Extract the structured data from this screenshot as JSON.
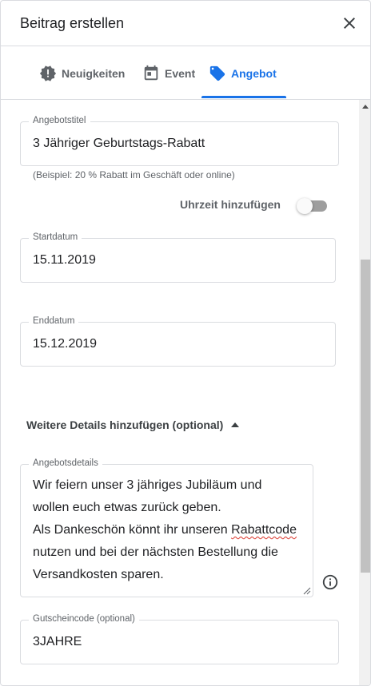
{
  "dialog": {
    "title": "Beitrag erstellen"
  },
  "tabs": [
    {
      "label": "Neuigkeiten",
      "icon": "badge-alert-icon"
    },
    {
      "label": "Event",
      "icon": "calendar-icon"
    },
    {
      "label": "Angebot",
      "icon": "tag-icon",
      "active": true
    }
  ],
  "form": {
    "offer_title": {
      "label": "Angebotstitel",
      "value": "3 Jähriger Geburtstags-Rabatt",
      "helper": "(Beispiel: 20 % Rabatt im Geschäft oder online)"
    },
    "add_time": {
      "label": "Uhrzeit hinzufügen",
      "enabled": false
    },
    "start_date": {
      "label": "Startdatum",
      "value": "15.11.2019"
    },
    "end_date": {
      "label": "Enddatum",
      "value": "15.12.2019"
    },
    "more_details": {
      "label": "Weitere Details hinzufügen (optional)",
      "expanded": true
    },
    "offer_details": {
      "label": "Angebotsdetails",
      "lines": [
        "Wir feiern unser 3 jähriges Jubiläum und",
        "wollen euch etwas zurück geben.",
        "Als Dankeschön könnt ihr unseren ",
        "Rabattcode",
        "nutzen und bei der nächsten Bestellung die",
        "Versandkosten sparen."
      ]
    },
    "voucher_code": {
      "label": "Gutscheincode (optional)",
      "value": "3JAHRE"
    }
  },
  "colors": {
    "accent": "#1a73e8",
    "text": "#202124",
    "secondary_text": "#5f6368",
    "border": "#dadce0"
  }
}
